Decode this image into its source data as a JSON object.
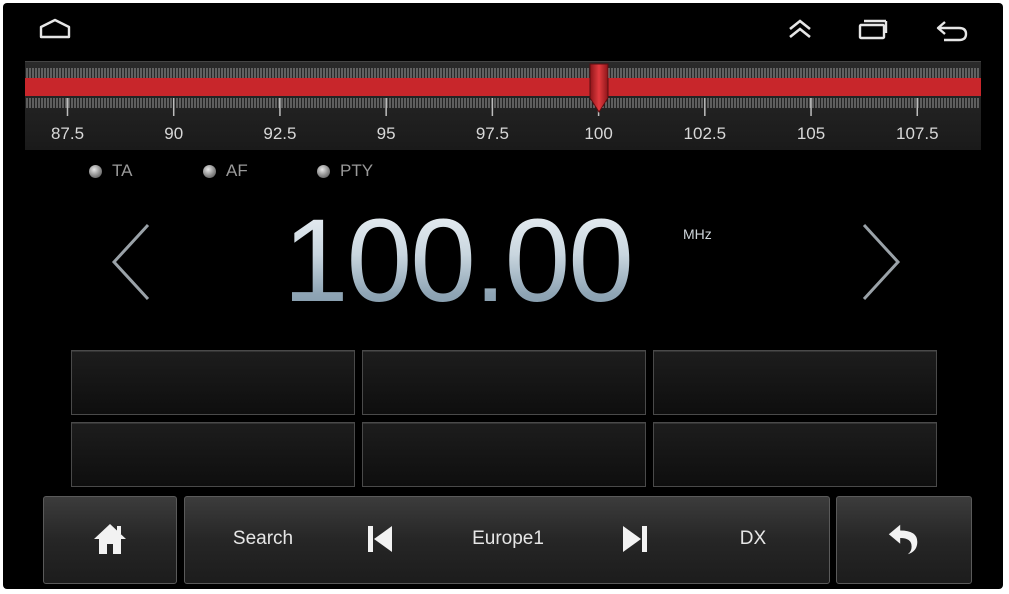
{
  "status_bar": {
    "home_icon": "home-outline-icon",
    "up_icon": "double-chevron-up-icon",
    "recents_icon": "recent-apps-icon",
    "back_icon": "back-arrow-icon"
  },
  "tuner": {
    "min": 86.5,
    "max": 109,
    "current": 100,
    "tick_labels": [
      "87.5",
      "90",
      "92.5",
      "95",
      "97.5",
      "100",
      "102.5",
      "105",
      "107.5"
    ],
    "band_color": "#c8262b"
  },
  "indicators": [
    {
      "label": "TA"
    },
    {
      "label": "AF"
    },
    {
      "label": "PTY"
    }
  ],
  "frequency": {
    "value": "100.00",
    "unit": "MHz"
  },
  "presets": [
    "",
    "",
    "",
    "",
    "",
    ""
  ],
  "bottom_bar": {
    "home_icon": "home-icon",
    "search_label": "Search",
    "prev_icon": "skip-previous-icon",
    "region_label": "Europe1",
    "next_icon": "skip-next-icon",
    "dx_label": "DX",
    "return_icon": "return-arrow-icon"
  }
}
